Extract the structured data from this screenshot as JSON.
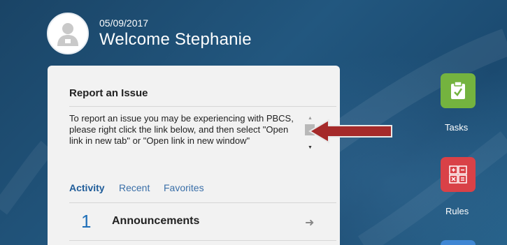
{
  "header": {
    "date": "05/09/2017",
    "welcome": "Welcome Stephanie"
  },
  "report_panel": {
    "title": "Report an Issue",
    "message": "To report an issue you may be experiencing with PBCS, please right click the link below, and then select \"Open link in new tab\" or \"Open link in new window\""
  },
  "tabs": [
    {
      "label": "Activity",
      "active": true
    },
    {
      "label": "Recent",
      "active": false
    },
    {
      "label": "Favorites",
      "active": false
    }
  ],
  "announcements": {
    "count": "1",
    "label": "Announcements"
  },
  "nav_tiles": [
    {
      "label": "Tasks",
      "icon": "clipboard-check-icon",
      "color": "#74b33f"
    },
    {
      "label": "Rules",
      "icon": "calculator-icon",
      "color": "#d94147"
    },
    {
      "label": "",
      "icon": "tile-icon",
      "color": "#3f86d3"
    }
  ],
  "colors": {
    "background": "#1d4a6e",
    "accent_link": "#3a6fa8",
    "callout_arrow": "#a52a2a"
  }
}
